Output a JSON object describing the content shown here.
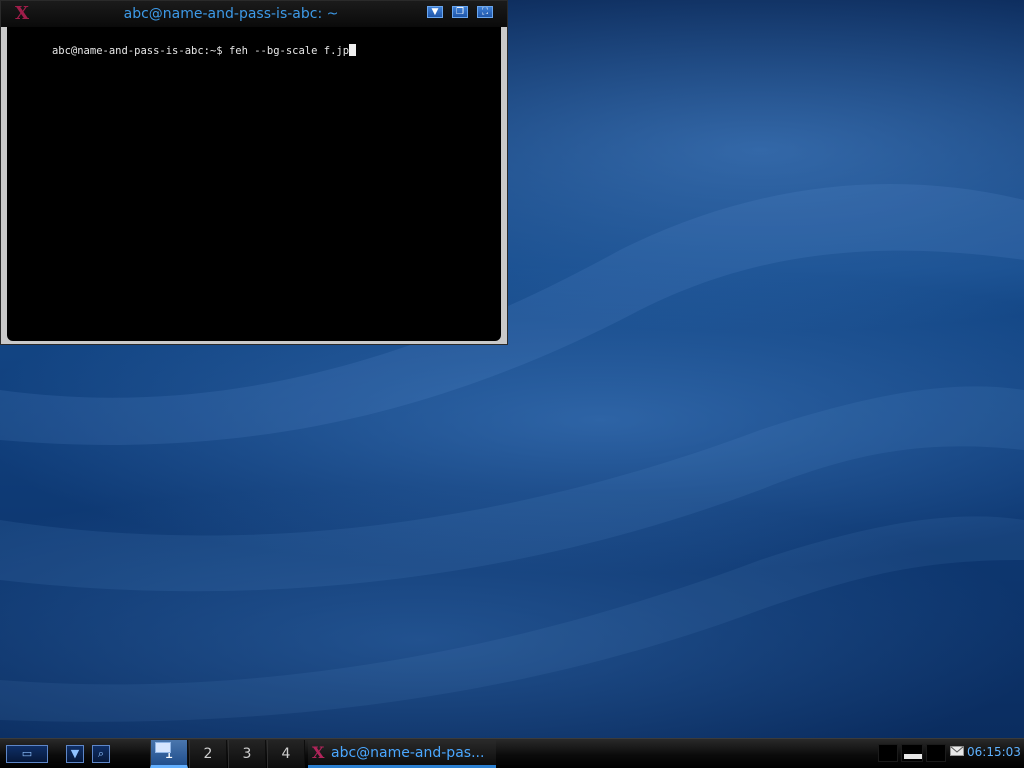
{
  "terminal": {
    "title": "abc@name-and-pass-is-abc: ~",
    "prompt_line": "abc@name-and-pass-is-abc:~$ feh --bg-scale f.jp"
  },
  "taskbar": {
    "workspaces": [
      "1",
      "2",
      "3",
      "4"
    ],
    "active_workspace": "1",
    "task_label": "abc@name-and-pas...",
    "clock": "06:15:03"
  },
  "colors": {
    "accent_blue": "#3d9ae8",
    "taskbar_bg": "#0b0b0b",
    "terminal_bg": "#000000"
  },
  "icons": {
    "app_icon": "x-terminal-icon",
    "minimize": "minimize-icon",
    "restore": "restore-icon",
    "maximize": "maximize-icon",
    "menu": "menu-icon",
    "dropdown": "chevron-down-icon",
    "search": "search-icon",
    "mail": "mail-icon"
  }
}
